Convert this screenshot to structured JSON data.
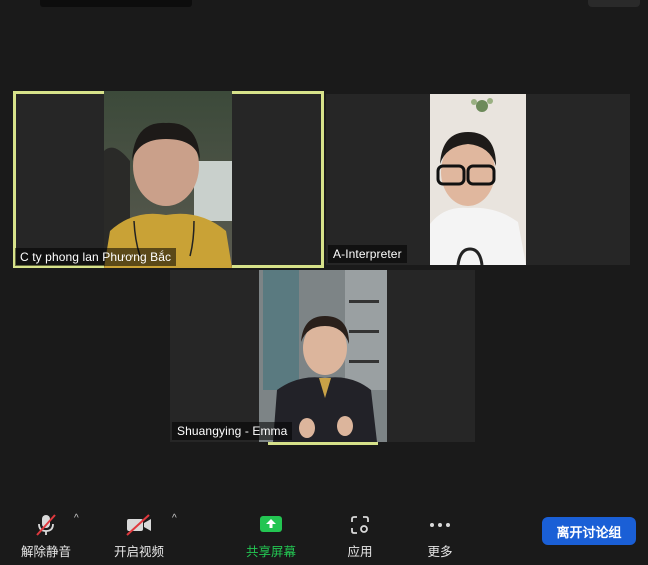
{
  "participants": [
    {
      "name": "C ty phong lan Phương Bắc",
      "active": true
    },
    {
      "name": "A-Interpreter",
      "active": false
    },
    {
      "name": "Shuangying - Emma",
      "active": false
    }
  ],
  "toolbar": {
    "unmute_label": "解除静音",
    "start_video_label": "开启视频",
    "share_screen_label": "共享屏幕",
    "apps_label": "应用",
    "more_label": "更多",
    "leave_breakout_label": "离开讨论组"
  },
  "colors": {
    "active_speaker_border": "#d7e28a",
    "share_green": "#23c552",
    "leave_blue": "#1a5fd6",
    "muted_red": "#e0393e"
  }
}
